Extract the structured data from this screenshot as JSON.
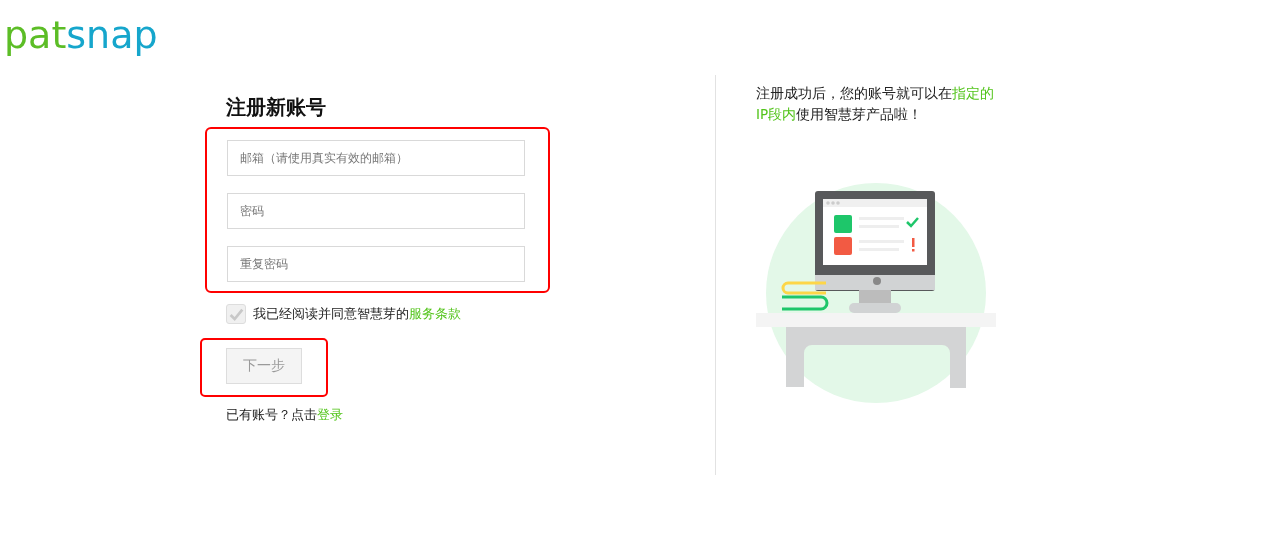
{
  "logo": {
    "parts": [
      {
        "text": "pat",
        "color": "#5cbd26"
      },
      {
        "text": "snap",
        "color": "#16a6cc"
      }
    ]
  },
  "form": {
    "title": "注册新账号",
    "fields_highlighted": true,
    "fields": [
      {
        "placeholder": "邮箱（请使用真实有效的邮箱）"
      },
      {
        "placeholder": "密码"
      },
      {
        "placeholder": "重复密码"
      }
    ],
    "agreement": {
      "checked": true,
      "text": "我已经阅读并同意智慧芽的",
      "link": "服务条款"
    },
    "next_button": {
      "label": "下一步",
      "disabled": true,
      "highlighted": true
    },
    "login_prompt": {
      "text": "已有账号？点击",
      "link": "登录"
    }
  },
  "info": {
    "segments": [
      {
        "text": "注册成功后，您的账号就可以在",
        "emphasis": false
      },
      {
        "text": "指定的IP段内",
        "emphasis": true
      },
      {
        "text": "使用智慧芽产品啦！",
        "emphasis": false
      }
    ]
  }
}
